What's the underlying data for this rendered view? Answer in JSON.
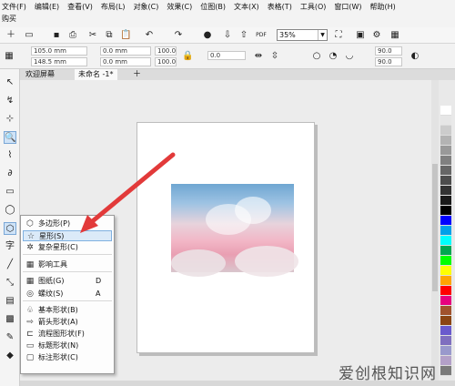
{
  "menubar": {
    "row1": [
      "文件(F)",
      "编辑(E)",
      "查看(V)",
      "布局(L)",
      "对象(C)",
      "效果(C)",
      "位图(B)",
      "文本(X)",
      "表格(T)",
      "工具(O)",
      "窗口(W)",
      "帮助(H)"
    ],
    "row2": [
      "购买"
    ]
  },
  "toolbar": {
    "zoom_value": "35%",
    "pdf_label": "PDF"
  },
  "propbar": {
    "x": "105.0 mm",
    "y": "148.5 mm",
    "w": "0.0 mm",
    "h": "0.0 mm",
    "scale_x": "100.0",
    "scale_y": "100.0",
    "rotation": "0.0",
    "angle1": "90.0",
    "angle2": "90.0"
  },
  "tabs": [
    "欢迎屏幕",
    "未命名 -1*"
  ],
  "flyout": {
    "items": [
      {
        "icon": "⬡",
        "label": "多边形(P)",
        "shortcut": ""
      },
      {
        "icon": "☆",
        "label": "星形(S)",
        "shortcut": ""
      },
      {
        "icon": "✲",
        "label": "复杂星形(C)",
        "shortcut": ""
      },
      {
        "icon": "▦",
        "label": "影响工具",
        "shortcut": ""
      },
      {
        "icon": "▦",
        "label": "图纸(G)",
        "shortcut": "D"
      },
      {
        "icon": "◎",
        "label": "螺纹(S)",
        "shortcut": "A"
      },
      {
        "icon": "♧",
        "label": "基本形状(B)",
        "shortcut": ""
      },
      {
        "icon": "⇨",
        "label": "箭头形状(A)",
        "shortcut": ""
      },
      {
        "icon": "⊏",
        "label": "流程图形状(F)",
        "shortcut": ""
      },
      {
        "icon": "▭",
        "label": "标题形状(N)",
        "shortcut": ""
      },
      {
        "icon": "▢",
        "label": "标注形状(C)",
        "shortcut": ""
      }
    ]
  },
  "palette_colors": [
    "#ffffff",
    "#e6e6e6",
    "#cccccc",
    "#b3b3b3",
    "#999999",
    "#808080",
    "#666666",
    "#4d4d4d",
    "#333333",
    "#1a1a1a",
    "#000000",
    "#0000ff",
    "#00a0e9",
    "#00ffff",
    "#00a651",
    "#00ff00",
    "#ffff00",
    "#ffa500",
    "#ff0000",
    "#e6007e",
    "#a0522d",
    "#8b4513",
    "#6a5acd",
    "#7f6fbf",
    "#9999cc",
    "#b3a0c8",
    "#7a7a7a"
  ],
  "watermark": "爱创根知识网",
  "tools": [
    "↖",
    "↯",
    "⊹",
    "🔍",
    "⌇",
    "∂",
    "▭",
    "◯",
    "⬡",
    "字",
    "╱",
    "⤡",
    "▤",
    "▩",
    "✎",
    "◆"
  ]
}
